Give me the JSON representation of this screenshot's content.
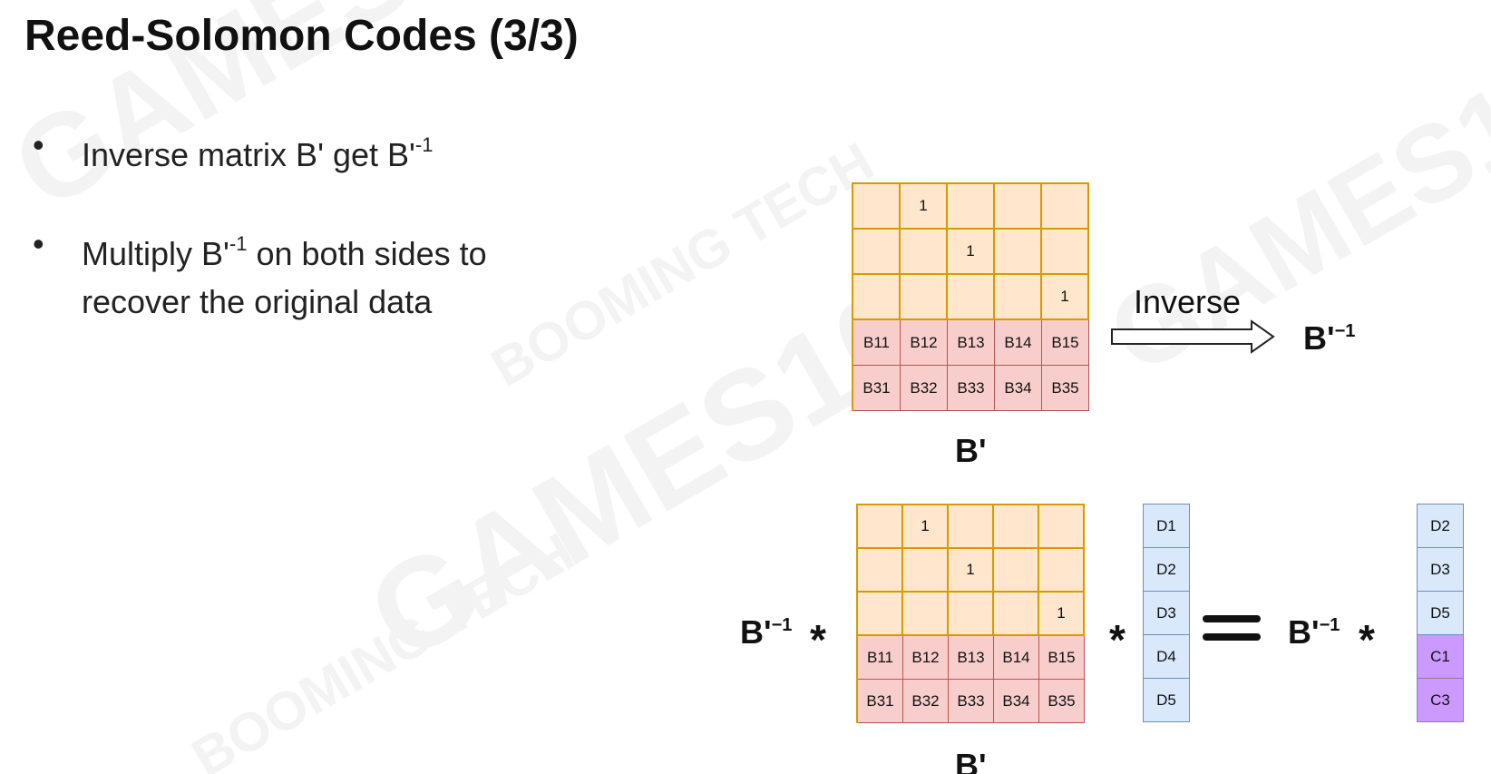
{
  "title": "Reed-Solomon Codes (3/3)",
  "watermark": [
    "GAMES104",
    "BOOMING TECH"
  ],
  "bullets": [
    {
      "marker": "•",
      "text": "Inverse matrix B' get B'",
      "sup": "-1"
    },
    {
      "marker": "•",
      "pre": "Multiply B'",
      "sup": "-1",
      "post": " on both sides to",
      "line2": "recover the original data"
    }
  ],
  "matrix_top": {
    "identity_rows": [
      [
        "",
        "1",
        "",
        "",
        ""
      ],
      [
        "",
        "",
        "1",
        "",
        ""
      ],
      [
        "",
        "",
        "",
        "",
        "1"
      ]
    ],
    "data_rows": [
      [
        "B11",
        "B12",
        "B13",
        "B14",
        "B15"
      ],
      [
        "B31",
        "B32",
        "B33",
        "B34",
        "B35"
      ]
    ],
    "label": "B'"
  },
  "inverse": {
    "label": "Inverse",
    "result": "B'",
    "result_sup": "−1"
  },
  "equation": {
    "left_factor": "B'",
    "left_sup": "−1",
    "star": "*",
    "equals": "=",
    "right_factor": "B'",
    "right_sup": "−1",
    "matrix_label": "B'",
    "d_vector": [
      "D1",
      "D2",
      "D3",
      "D4",
      "D5"
    ],
    "result_vector": [
      "D2",
      "D3",
      "D5",
      "C1",
      "C3"
    ],
    "result_parity": [
      false,
      false,
      false,
      true,
      true
    ]
  },
  "colors": {
    "identity_fill": "#ffe6cc",
    "identity_stroke": "#d79b00",
    "data_fill": "#f8cecc",
    "data_stroke": "#b85450",
    "vector_fill": "#dae8fc",
    "vector_stroke": "#6c8ebf",
    "parity_fill": "#cc99ff"
  }
}
